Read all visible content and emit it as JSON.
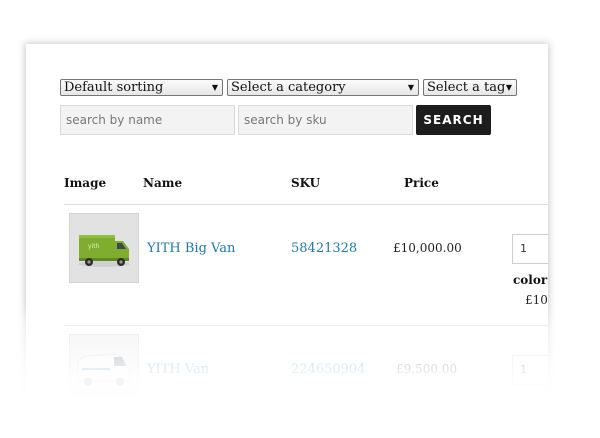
{
  "filters": {
    "sorting": "Default sorting",
    "category": "Select a category",
    "tag": "Select a tag",
    "search_name_placeholder": "search by name",
    "search_sku_placeholder": "search by sku",
    "search_button": "SEARCH"
  },
  "table": {
    "headers": {
      "image": "Image",
      "name": "Name",
      "sku": "SKU",
      "price": "Price"
    },
    "rows": [
      {
        "name": "YITH Big Van",
        "sku": "58421328",
        "price": "£10,000.00",
        "qty": "1",
        "attribute_label": "color",
        "attribute_price": "£10"
      },
      {
        "name": "YITH Van",
        "sku": "224650904",
        "price": "£9,500.00",
        "qty": "1"
      }
    ]
  },
  "colors": {
    "link": "#1a78b7",
    "button_bg": "#1d1d1d",
    "van_green": "#7fae2e"
  }
}
